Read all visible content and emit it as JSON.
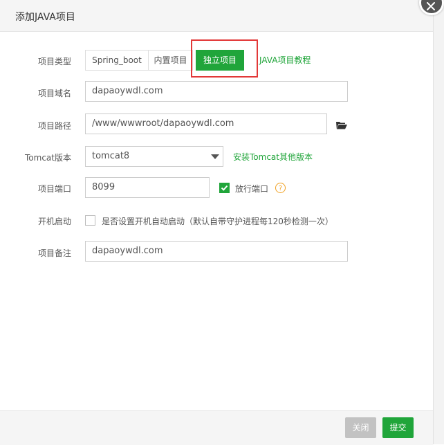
{
  "dialog": {
    "title": "添加JAVA项目"
  },
  "form": {
    "type": {
      "label": "项目类型",
      "options": [
        "Spring_boot",
        "内置项目",
        "独立项目"
      ],
      "selected": "独立项目",
      "tutorial_link": "JAVA项目教程"
    },
    "domain": {
      "label": "项目域名",
      "value": "dapaoywdl.com"
    },
    "path": {
      "label": "项目路径",
      "value": "/www/wwwroot/dapaoywdl.com"
    },
    "tomcat": {
      "label": "Tomcat版本",
      "value": "tomcat8",
      "install_link": "安装Tomcat其他版本"
    },
    "port": {
      "label": "项目端口",
      "value": "8099",
      "allow_port_label": "放行端口",
      "allow_port_checked": true,
      "help_glyph": "?"
    },
    "autostart": {
      "label": "开机启动",
      "checked": false,
      "text": "是否设置开机自动启动（默认自带守护进程每120秒检测一次）"
    },
    "remark": {
      "label": "项目备注",
      "value": "dapaoywdl.com"
    }
  },
  "footer": {
    "close_label": "关闭",
    "submit_label": "提交"
  },
  "colors": {
    "accent": "#20a53a",
    "highlight": "#e23838",
    "help": "#f0a020",
    "disabled": "#c2c2c2"
  },
  "icons": [
    "close-icon",
    "folder-open-icon",
    "chevron-down-icon",
    "checkmark-icon",
    "help-icon"
  ]
}
